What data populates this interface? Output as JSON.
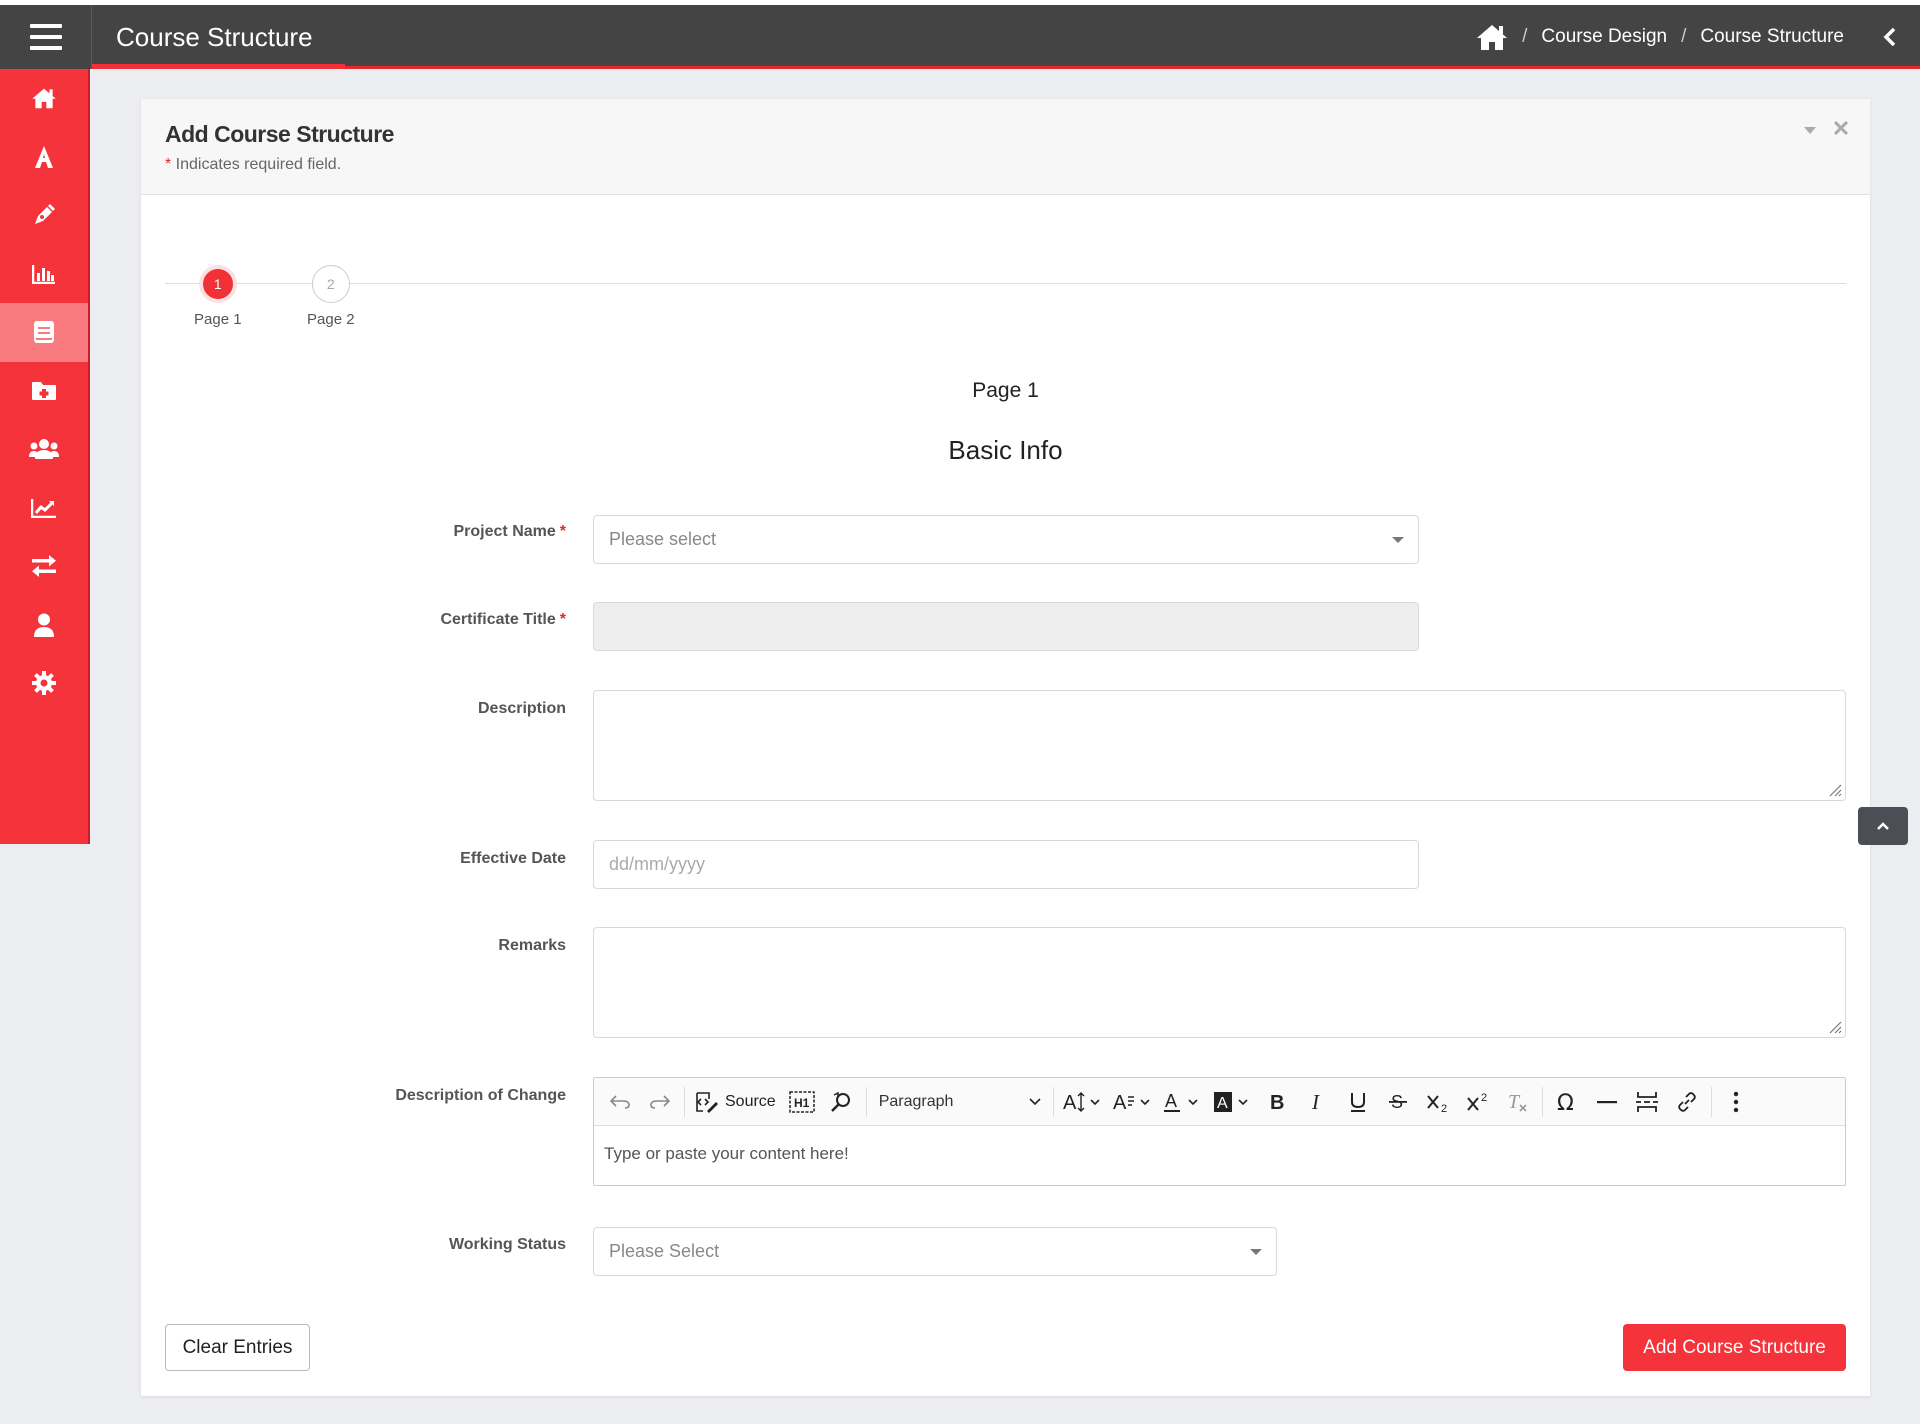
{
  "header": {
    "title": "Course Structure",
    "breadcrumb": [
      "Course Design",
      "Course Structure"
    ]
  },
  "sidebar": {
    "items": [
      {
        "icon": "home-icon"
      },
      {
        "icon": "font-icon"
      },
      {
        "icon": "pen-icon"
      },
      {
        "icon": "bar-chart-icon"
      },
      {
        "icon": "book-icon",
        "active": true
      },
      {
        "icon": "folder-plus-icon"
      },
      {
        "icon": "users-icon"
      },
      {
        "icon": "line-chart-icon"
      },
      {
        "icon": "exchange-icon"
      },
      {
        "icon": "user-icon"
      },
      {
        "icon": "gear-icon"
      }
    ]
  },
  "card": {
    "title": "Add Course Structure",
    "required_star": "*",
    "required_note": " Indicates required field."
  },
  "stepper": {
    "steps": [
      {
        "number": "1",
        "label": "Page 1"
      },
      {
        "number": "2",
        "label": "Page 2"
      }
    ]
  },
  "section": {
    "page": "Page 1",
    "title": "Basic Info"
  },
  "form": {
    "project_name": {
      "label": "Project Name",
      "placeholder": "Please select"
    },
    "certificate_title": {
      "label": "Certificate Title",
      "value": ""
    },
    "description": {
      "label": "Description",
      "value": ""
    },
    "effective_date": {
      "label": "Effective Date",
      "placeholder": "dd/mm/yyyy"
    },
    "remarks": {
      "label": "Remarks",
      "value": ""
    },
    "description_of_change": {
      "label": "Description of Change",
      "placeholder": "Type or paste your content here!",
      "toolbar": {
        "source": "Source",
        "paragraph": "Paragraph"
      }
    },
    "working_status": {
      "label": "Working Status",
      "placeholder": "Please Select"
    },
    "required_star": "*"
  },
  "buttons": {
    "clear": "Clear Entries",
    "add": "Add Course Structure"
  },
  "colors": {
    "accent": "#f5333b",
    "topbar": "#444444"
  }
}
